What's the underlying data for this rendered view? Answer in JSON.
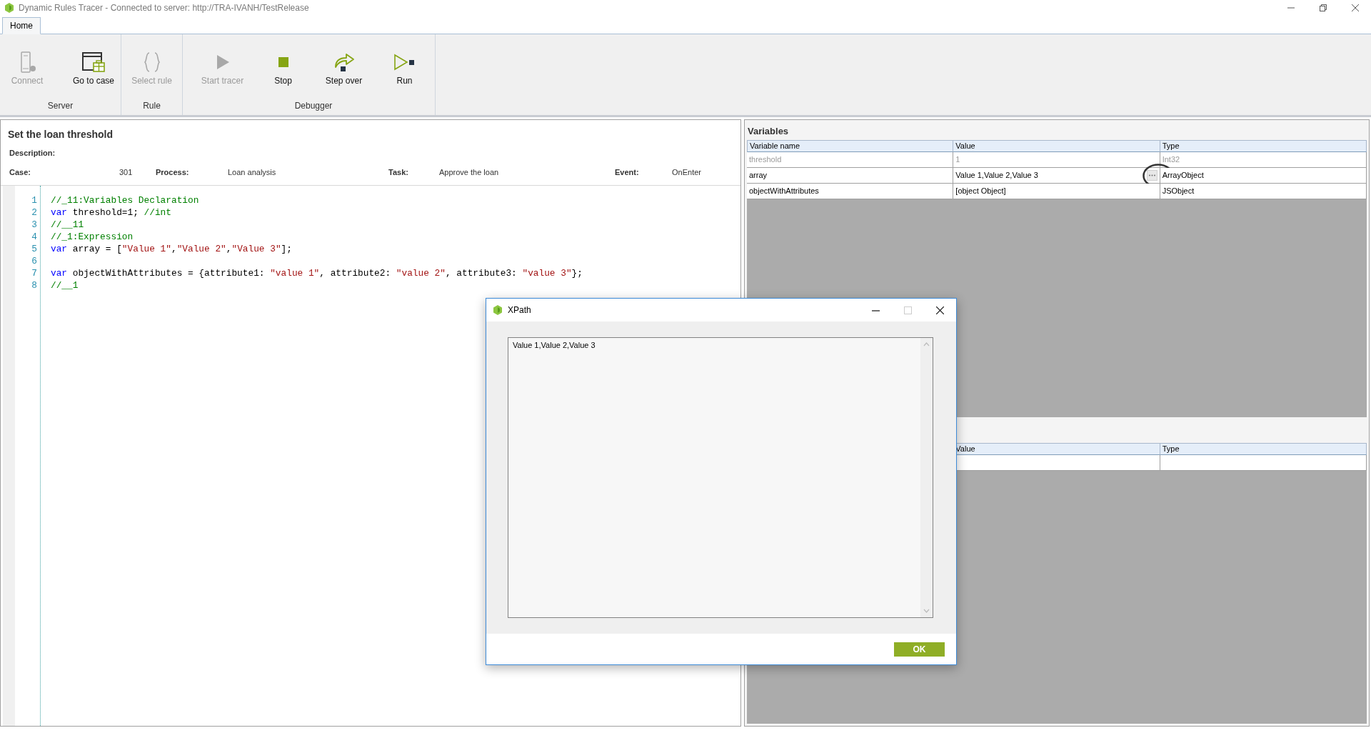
{
  "window": {
    "title": "Dynamic Rules Tracer - Connected to server: http://TRA-IVANH/TestRelease"
  },
  "tabs": [
    {
      "label": "Home",
      "selected": true
    }
  ],
  "ribbon": {
    "groups": [
      {
        "label": "Server",
        "buttons": [
          {
            "kind": "connect",
            "label": "Connect",
            "disabled": true
          },
          {
            "kind": "case",
            "label": "Go to case",
            "disabled": false
          }
        ]
      },
      {
        "label": "Rule",
        "buttons": [
          {
            "kind": "rule",
            "label": "Select rule",
            "disabled": true
          }
        ]
      },
      {
        "label": "Debugger",
        "buttons": [
          {
            "kind": "start",
            "label": "Start tracer",
            "disabled": true
          },
          {
            "kind": "stop",
            "label": "Stop",
            "disabled": false
          },
          {
            "kind": "step",
            "label": "Step over",
            "disabled": false
          },
          {
            "kind": "run",
            "label": "Run",
            "disabled": false
          }
        ]
      }
    ]
  },
  "rule": {
    "title": "Set the loan threshold",
    "description_label": "Description:",
    "fields": [
      {
        "label": "Case:",
        "value": "301"
      },
      {
        "label": "Process:",
        "value": "Loan analysis"
      },
      {
        "label": "Task:",
        "value": "Approve the loan"
      },
      {
        "label": "Event:",
        "value": "OnEnter"
      }
    ]
  },
  "code": {
    "lines": [
      {
        "number": "1",
        "tokens": [
          {
            "kind": "comment",
            "text": "//_11:Variables Declaration"
          }
        ]
      },
      {
        "number": "2",
        "tokens": [
          {
            "kind": "keyword",
            "text": "var"
          },
          {
            "kind": "plain",
            "text": " threshold=1; "
          },
          {
            "kind": "comment",
            "text": "//int"
          }
        ]
      },
      {
        "number": "3",
        "tokens": [
          {
            "kind": "comment",
            "text": "//__11"
          }
        ]
      },
      {
        "number": "4",
        "tokens": [
          {
            "kind": "comment",
            "text": "//_1:Expression"
          }
        ]
      },
      {
        "number": "5",
        "tokens": [
          {
            "kind": "keyword",
            "text": "var"
          },
          {
            "kind": "plain",
            "text": " array = ["
          },
          {
            "kind": "string",
            "text": "\"Value 1\""
          },
          {
            "kind": "plain",
            "text": ","
          },
          {
            "kind": "string",
            "text": "\"Value 2\""
          },
          {
            "kind": "plain",
            "text": ","
          },
          {
            "kind": "string",
            "text": "\"Value 3\""
          },
          {
            "kind": "plain",
            "text": "];"
          }
        ]
      },
      {
        "number": "6"
      },
      {
        "number": "7",
        "tokens": [
          {
            "kind": "keyword",
            "text": "var"
          },
          {
            "kind": "plain",
            "text": " objectWithAttributes = {attribute1: "
          },
          {
            "kind": "string",
            "text": "\"value 1\""
          },
          {
            "kind": "plain",
            "text": ", attribute2: "
          },
          {
            "kind": "string",
            "text": "\"value 2\""
          },
          {
            "kind": "plain",
            "text": ", attribute3: "
          },
          {
            "kind": "string",
            "text": "\"value 3\""
          },
          {
            "kind": "plain",
            "text": "};"
          }
        ]
      },
      {
        "number": "8",
        "tokens": [
          {
            "kind": "comment",
            "text": "//__1"
          }
        ]
      }
    ]
  },
  "variables": {
    "title": "Variables",
    "columns": [
      "Variable name",
      "Value",
      "Type"
    ],
    "rows": [
      {
        "name": "threshold",
        "value": "1",
        "type": "Int32",
        "disabled": true,
        "editor_button": false,
        "highlighted": false
      },
      {
        "name": "array",
        "value": "Value 1,Value 2,Value 3",
        "type": "ArrayObject",
        "disabled": false,
        "editor_button": true,
        "highlighted": true
      },
      {
        "name": "objectWithAttributes",
        "value": "[object Object]",
        "type": "JSObject",
        "disabled": false,
        "editor_button": false,
        "highlighted": false
      }
    ]
  },
  "lower_table": {
    "columns": [
      "Value",
      "Type"
    ]
  },
  "dialog": {
    "title": "XPath",
    "value": "Value 1,Value 2,Value 3",
    "ok_label": "OK"
  }
}
